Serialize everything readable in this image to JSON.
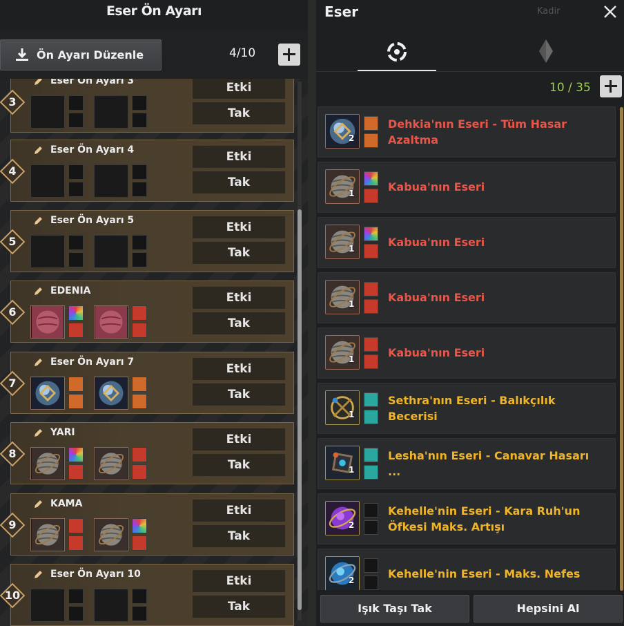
{
  "left_panel": {
    "title": "Eser Ön Ayarı",
    "edit_button_label": "Ön Ayarı Düzenle",
    "count": "4/10",
    "slots": [
      {
        "number": "3",
        "name": "Eser Ön Ayarı 3",
        "effect_label": "Etki",
        "equip_label": "Tak",
        "filled": false
      },
      {
        "number": "4",
        "name": "Eser Ön Ayarı 4",
        "effect_label": "Etki",
        "equip_label": "Tak",
        "filled": false
      },
      {
        "number": "5",
        "name": "Eser Ön Ayarı 5",
        "effect_label": "Etki",
        "equip_label": "Tak",
        "filled": false
      },
      {
        "number": "6",
        "name": "EDENIA",
        "effect_label": "Etki",
        "equip_label": "Tak",
        "filled": true,
        "artifact": "red-sphere"
      },
      {
        "number": "7",
        "name": "Eser Ön Ayarı 7",
        "effect_label": "Etki",
        "equip_label": "Tak",
        "filled": true,
        "artifact": "blue-orb"
      },
      {
        "number": "8",
        "name": "YARI",
        "effect_label": "Etki",
        "equip_label": "Tak",
        "filled": true,
        "artifact": "stone-sphere"
      },
      {
        "number": "9",
        "name": "KAMA",
        "effect_label": "Etki",
        "equip_label": "Tak",
        "filled": true,
        "artifact": "stone-sphere"
      },
      {
        "number": "10",
        "name": "Eser Ön Ayarı 10",
        "effect_label": "Etki",
        "equip_label": "Tak",
        "filled": false
      }
    ]
  },
  "right_panel": {
    "title": "Eser",
    "faded_label": "Kadir",
    "count": "10 / 35",
    "tabs": [
      {
        "icon": "artifact-ring-icon",
        "active": true
      },
      {
        "icon": "crystal-icon",
        "active": false
      }
    ],
    "items": [
      {
        "title": "Dehkia'nın Eseri - Tüm Hasar Azaltma",
        "color": "red",
        "count": "2",
        "icon": "blue-orb",
        "gems": [
          "orange",
          "orange"
        ]
      },
      {
        "title": "Kabua'nın Eseri",
        "color": "red",
        "count": "1",
        "icon": "stone-sphere",
        "gems": [
          "rainbow",
          "red"
        ]
      },
      {
        "title": "Kabua'nın Eseri",
        "color": "red",
        "count": "1",
        "icon": "stone-sphere",
        "gems": [
          "rainbow",
          "red"
        ]
      },
      {
        "title": "Kabua'nın Eseri",
        "color": "red",
        "count": "1",
        "icon": "stone-sphere",
        "gems": [
          "red",
          "red"
        ]
      },
      {
        "title": "Kabua'nın Eseri",
        "color": "red",
        "count": "1",
        "icon": "stone-sphere",
        "gems": [
          "red",
          "red"
        ]
      },
      {
        "title": "Sethra'nın Eseri - Balıkçılık Becerisi",
        "color": "gold",
        "count": "1",
        "icon": "gold-cage",
        "gems": [
          "teal",
          "teal"
        ]
      },
      {
        "title": "Lesha'nın Eseri - Canavar Hasarı ...",
        "color": "gold",
        "count": "1",
        "icon": "dark-cube",
        "gems": [
          "teal",
          "teal"
        ]
      },
      {
        "title": "Kehelle'nin Eseri - Kara Ruh'un Öfkesi Maks. Artışı",
        "color": "gold",
        "count": "2",
        "icon": "purple-orb",
        "gems": [
          "empty",
          "empty"
        ]
      },
      {
        "title": "Kehelle'nin Eseri - Maks. Nefes",
        "color": "gold",
        "count": "2",
        "icon": "cyan-orb",
        "gems": [
          "empty",
          "empty"
        ]
      }
    ],
    "buttons": {
      "light_stone": "Işık Taşı Tak",
      "take_all": "Hepsini Al"
    }
  },
  "colors": {
    "red_title": "#e8564a",
    "gold_title": "#f0b429",
    "count_green": "#9dd04f",
    "slot_border": "#7a6649"
  }
}
